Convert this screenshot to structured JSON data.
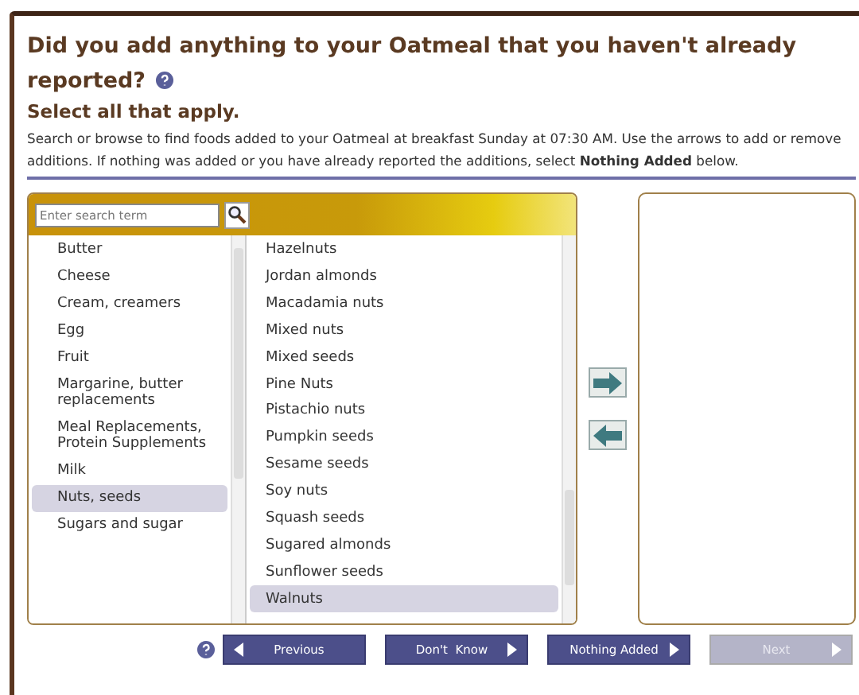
{
  "question": {
    "title": "Did you add anything to your Oatmeal that you haven't already reported?",
    "subtitle": "Select all that apply.",
    "instructions": "Search or browse to find foods added to your Oatmeal at breakfast Sunday at 07:30 AM. Use the arrows to add or remove additions. If nothing was added or you have already reported the additions, select **Nothing Added** below."
  },
  "search": {
    "placeholder": "Enter search term"
  },
  "categories": [
    {
      "label": "Butter",
      "selected": false
    },
    {
      "label": "Cheese",
      "selected": false
    },
    {
      "label": "Cream, creamers",
      "selected": false
    },
    {
      "label": "Egg",
      "selected": false
    },
    {
      "label": "Fruit",
      "selected": false
    },
    {
      "label": "Margarine, butter replacements",
      "selected": false
    },
    {
      "label": "Meal Replacements, Protein Supplements",
      "selected": false
    },
    {
      "label": "Milk",
      "selected": false
    },
    {
      "label": "Nuts, seeds",
      "selected": true
    },
    {
      "label": "Sugars and sugar",
      "selected": false
    }
  ],
  "foods": [
    {
      "label": "Hazelnuts",
      "selected": false
    },
    {
      "label": "Jordan almonds",
      "selected": false
    },
    {
      "label": "Macadamia nuts",
      "selected": false
    },
    {
      "label": "Mixed nuts",
      "selected": false
    },
    {
      "label": "Mixed seeds",
      "selected": false
    },
    {
      "label": "Pine Nuts",
      "selected": false
    },
    {
      "label": "Pistachio nuts",
      "selected": false
    },
    {
      "label": "Pumpkin seeds",
      "selected": false
    },
    {
      "label": "Sesame seeds",
      "selected": false
    },
    {
      "label": "Soy nuts",
      "selected": false
    },
    {
      "label": "Squash seeds",
      "selected": false
    },
    {
      "label": "Sugared almonds",
      "selected": false
    },
    {
      "label": "Sunflower seeds",
      "selected": false
    },
    {
      "label": "Walnuts",
      "selected": true
    }
  ],
  "nav_buttons": [
    {
      "label": "Previous",
      "kind": "back",
      "disabled": false
    },
    {
      "label": "Don't  Know",
      "kind": "forward",
      "disabled": false
    },
    {
      "label": "Nothing Added",
      "kind": "forward",
      "disabled": false
    },
    {
      "label": "Next",
      "kind": "forward",
      "disabled": true
    }
  ]
}
